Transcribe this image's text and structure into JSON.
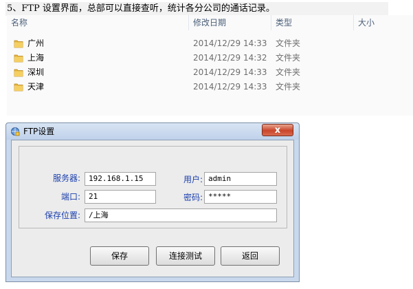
{
  "caption": "5、FTP 设置界面，总部可以直接查听，统计各分公司的通话记录。",
  "explorer": {
    "columns": {
      "name": "名称",
      "modified": "修改日期",
      "type": "类型",
      "size": "大小"
    },
    "rows": [
      {
        "name": "广州",
        "modified": "2014/12/29 14:33",
        "type": "文件夹"
      },
      {
        "name": "上海",
        "modified": "2014/12/29 14:32",
        "type": "文件夹"
      },
      {
        "name": "深圳",
        "modified": "2014/12/29 14:33",
        "type": "文件夹"
      },
      {
        "name": "天津",
        "modified": "2014/12/29 14:33",
        "type": "文件夹"
      }
    ]
  },
  "dialog": {
    "title": "FTP设置",
    "close_label": "x",
    "server_label": "服务器:",
    "server_value": "192.168.1.15",
    "user_label": "用户:",
    "user_value": "admin",
    "port_label": "端口:",
    "port_value": "21",
    "password_label": "密码:",
    "password_value": "*****",
    "path_label": "保存位置:",
    "path_value": "/上海",
    "save_label": "保存",
    "test_label": "连接测试",
    "back_label": "返回"
  },
  "colors": {
    "label_blue": "#1b3fae",
    "folder_yellow": "#e8b63c",
    "close_red": "#c9452a"
  }
}
